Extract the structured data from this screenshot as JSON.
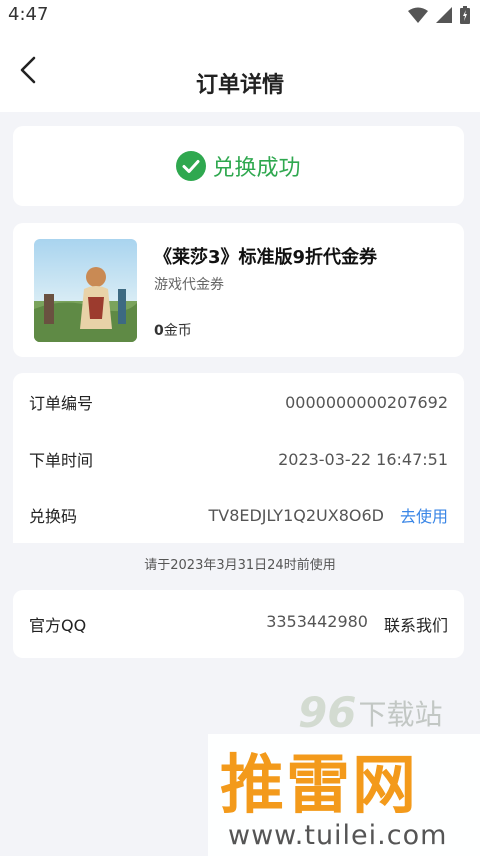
{
  "statusbar": {
    "time": "4:47"
  },
  "navbar": {
    "title": "订单详情"
  },
  "status": {
    "text": "兑换成功",
    "color": "#2fa84f"
  },
  "product": {
    "title": "《莱莎3》标准版9折代金券",
    "subtitle": "游戏代金券",
    "price_value": "0",
    "price_unit": "金币"
  },
  "order": {
    "number_label": "订单编号",
    "number_value": "0000000000207692",
    "time_label": "下单时间",
    "time_value": "2023-03-22 16:47:51",
    "code_label": "兑换码",
    "code_value": "TV8EDJLY1Q2UX8O6D",
    "use_link": "去使用"
  },
  "notice": "请于2023年3月31日24时前使用",
  "contact": {
    "label": "官方QQ",
    "qq_value": "3353442980",
    "contact_link": "联系我们"
  },
  "watermark": {
    "site_num": "96",
    "site_text": "下载站",
    "brand": "推雷网",
    "url": "www.tuilei.com"
  },
  "icons": [
    "wifi-icon",
    "signal-icon",
    "battery-icon",
    "back-arrow-icon",
    "check-circle-icon"
  ]
}
